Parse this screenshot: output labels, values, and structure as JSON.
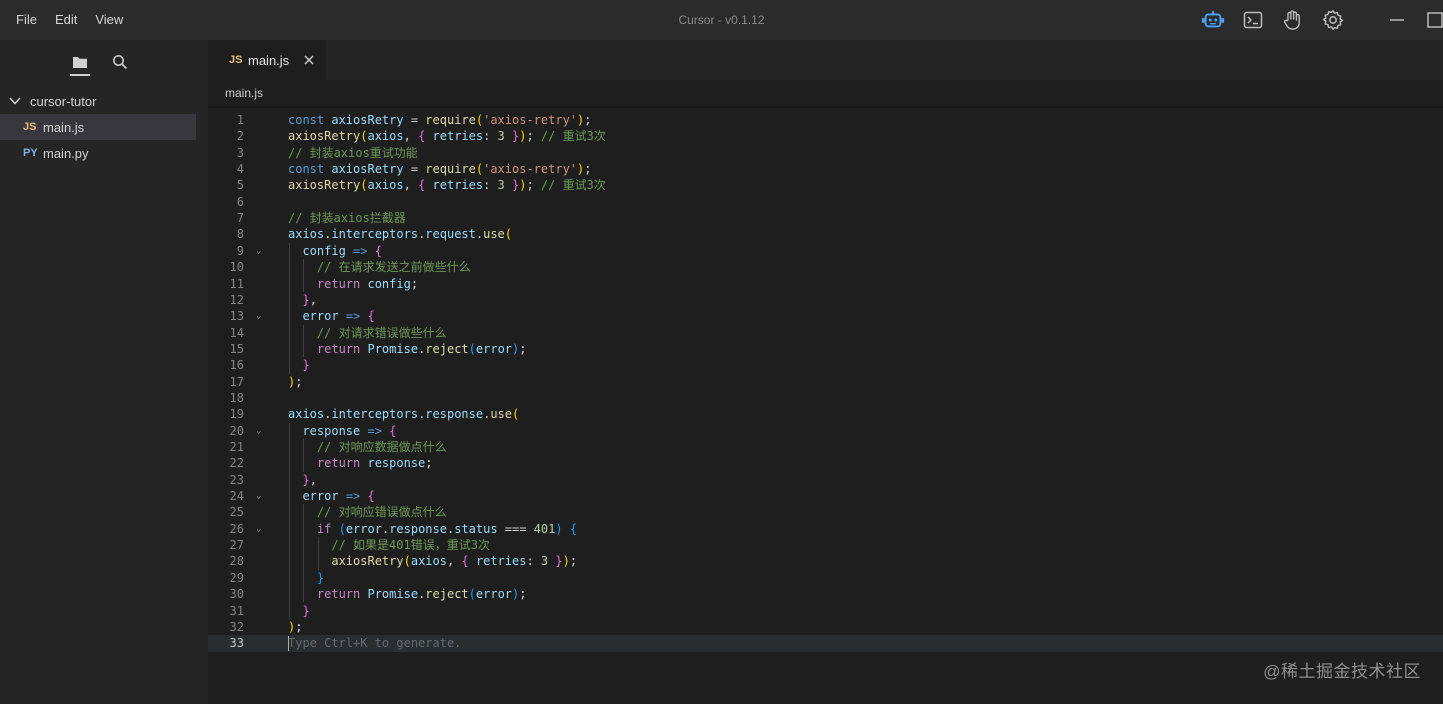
{
  "menu": {
    "file": "File",
    "edit": "Edit",
    "view": "View"
  },
  "app_title": "Cursor - v0.1.12",
  "title_icons": [
    "robot-icon",
    "terminal-icon",
    "hand-icon",
    "gear-icon"
  ],
  "sidebar": {
    "folder": "cursor-tutor",
    "files": [
      {
        "badge": "JS",
        "name": "main.js",
        "active": true
      },
      {
        "badge": "PY",
        "name": "main.py",
        "active": false
      }
    ]
  },
  "tab": {
    "badge": "JS",
    "label": "main.js"
  },
  "breadcrumb": "main.js",
  "editor": {
    "current_line": 33,
    "ghost_text": "Type Ctrl+K to generate.",
    "lines": [
      [
        [
          "kw",
          "const "
        ],
        [
          "var",
          "axiosRetry "
        ],
        [
          "",
          "= "
        ],
        [
          "fn",
          "require"
        ],
        [
          "pu1",
          "("
        ],
        [
          "str",
          "'axios-retry'"
        ],
        [
          "pu1",
          ")"
        ],
        [
          "",
          ";"
        ]
      ],
      [
        [
          "fn",
          "axiosRetry"
        ],
        [
          "pu1",
          "("
        ],
        [
          "var",
          "axios"
        ],
        [
          "",
          ", "
        ],
        [
          "pu2",
          "{ "
        ],
        [
          "var",
          "retries"
        ],
        [
          "",
          ": "
        ],
        [
          "num",
          "3 "
        ],
        [
          "pu2",
          "}"
        ],
        [
          "pu1",
          ")"
        ],
        [
          "",
          "; "
        ],
        [
          "cmt",
          "// 重试3次"
        ]
      ],
      [
        [
          "cmt",
          "// 封装axios重试功能"
        ]
      ],
      [
        [
          "kw",
          "const "
        ],
        [
          "var",
          "axiosRetry "
        ],
        [
          "",
          "= "
        ],
        [
          "fn",
          "require"
        ],
        [
          "pu1",
          "("
        ],
        [
          "str",
          "'axios-retry'"
        ],
        [
          "pu1",
          ")"
        ],
        [
          "",
          ";"
        ]
      ],
      [
        [
          "fn",
          "axiosRetry"
        ],
        [
          "pu1",
          "("
        ],
        [
          "var",
          "axios"
        ],
        [
          "",
          ", "
        ],
        [
          "pu2",
          "{ "
        ],
        [
          "var",
          "retries"
        ],
        [
          "",
          ": "
        ],
        [
          "num",
          "3 "
        ],
        [
          "pu2",
          "}"
        ],
        [
          "pu1",
          ")"
        ],
        [
          "",
          "; "
        ],
        [
          "cmt",
          "// 重试3次"
        ]
      ],
      [],
      [
        [
          "cmt",
          "// 封装axios拦截器"
        ]
      ],
      [
        [
          "var",
          "axios"
        ],
        [
          "",
          "."
        ],
        [
          "var",
          "interceptors"
        ],
        [
          "",
          "."
        ],
        [
          "var",
          "request"
        ],
        [
          "",
          "."
        ],
        [
          "fn",
          "use"
        ],
        [
          "pu1",
          "("
        ]
      ],
      [
        [
          "",
          "  "
        ],
        [
          "var",
          "config "
        ],
        [
          "kw",
          "=> "
        ],
        [
          "pu2",
          "{"
        ]
      ],
      [
        [
          "",
          "    "
        ],
        [
          "cmt",
          "// 在请求发送之前做些什么"
        ]
      ],
      [
        [
          "",
          "    "
        ],
        [
          "kwc",
          "return "
        ],
        [
          "var",
          "config"
        ],
        [
          "",
          ";"
        ]
      ],
      [
        [
          "",
          "  "
        ],
        [
          "pu2",
          "}"
        ],
        [
          "",
          ","
        ]
      ],
      [
        [
          "",
          "  "
        ],
        [
          "var",
          "error "
        ],
        [
          "kw",
          "=> "
        ],
        [
          "pu2",
          "{"
        ]
      ],
      [
        [
          "",
          "    "
        ],
        [
          "cmt",
          "// 对请求错误做些什么"
        ]
      ],
      [
        [
          "",
          "    "
        ],
        [
          "kwc",
          "return "
        ],
        [
          "var",
          "Promise"
        ],
        [
          "",
          "."
        ],
        [
          "fn",
          "reject"
        ],
        [
          "pu3",
          "("
        ],
        [
          "var",
          "error"
        ],
        [
          "pu3",
          ")"
        ],
        [
          "",
          ";"
        ]
      ],
      [
        [
          "",
          "  "
        ],
        [
          "pu2",
          "}"
        ]
      ],
      [
        [
          "pu1",
          ")"
        ],
        [
          "",
          ";"
        ]
      ],
      [],
      [
        [
          "var",
          "axios"
        ],
        [
          "",
          "."
        ],
        [
          "var",
          "interceptors"
        ],
        [
          "",
          "."
        ],
        [
          "var",
          "response"
        ],
        [
          "",
          "."
        ],
        [
          "fn",
          "use"
        ],
        [
          "pu1",
          "("
        ]
      ],
      [
        [
          "",
          "  "
        ],
        [
          "var",
          "response "
        ],
        [
          "kw",
          "=> "
        ],
        [
          "pu2",
          "{"
        ]
      ],
      [
        [
          "",
          "    "
        ],
        [
          "cmt",
          "// 对响应数据做点什么"
        ]
      ],
      [
        [
          "",
          "    "
        ],
        [
          "kwc",
          "return "
        ],
        [
          "var",
          "response"
        ],
        [
          "",
          ";"
        ]
      ],
      [
        [
          "",
          "  "
        ],
        [
          "pu2",
          "}"
        ],
        [
          "",
          ","
        ]
      ],
      [
        [
          "",
          "  "
        ],
        [
          "var",
          "error "
        ],
        [
          "kw",
          "=> "
        ],
        [
          "pu2",
          "{"
        ]
      ],
      [
        [
          "",
          "    "
        ],
        [
          "cmt",
          "// 对响应错误做点什么"
        ]
      ],
      [
        [
          "",
          "    "
        ],
        [
          "kwc",
          "if "
        ],
        [
          "pu3",
          "("
        ],
        [
          "var",
          "error"
        ],
        [
          "",
          "."
        ],
        [
          "var",
          "response"
        ],
        [
          "",
          "."
        ],
        [
          "var",
          "status "
        ],
        [
          "",
          "=== "
        ],
        [
          "num",
          "401"
        ],
        [
          "pu3",
          ") "
        ],
        [
          "pu3",
          "{"
        ]
      ],
      [
        [
          "",
          "      "
        ],
        [
          "cmt",
          "// 如果是401错误，重试3次"
        ]
      ],
      [
        [
          "",
          "      "
        ],
        [
          "fn",
          "axiosRetry"
        ],
        [
          "pu1",
          "("
        ],
        [
          "var",
          "axios"
        ],
        [
          "",
          ", "
        ],
        [
          "pu2",
          "{ "
        ],
        [
          "var",
          "retries"
        ],
        [
          "",
          ": "
        ],
        [
          "num",
          "3 "
        ],
        [
          "pu2",
          "}"
        ],
        [
          "pu1",
          ")"
        ],
        [
          "",
          ";"
        ]
      ],
      [
        [
          "",
          "    "
        ],
        [
          "pu3",
          "}"
        ]
      ],
      [
        [
          "",
          "    "
        ],
        [
          "kwc",
          "return "
        ],
        [
          "var",
          "Promise"
        ],
        [
          "",
          "."
        ],
        [
          "fn",
          "reject"
        ],
        [
          "pu3",
          "("
        ],
        [
          "var",
          "error"
        ],
        [
          "pu3",
          ")"
        ],
        [
          "",
          ";"
        ]
      ],
      [
        [
          "",
          "  "
        ],
        [
          "pu2",
          "}"
        ]
      ],
      [
        [
          "pu1",
          ")"
        ],
        [
          "",
          ";"
        ]
      ],
      []
    ],
    "fold_lines": [
      9,
      13,
      20,
      24,
      26
    ]
  },
  "watermark": "@稀土掘金技术社区"
}
